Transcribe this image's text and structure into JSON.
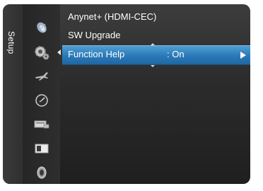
{
  "sidebar": {
    "title": "Setup",
    "icons": [
      {
        "name": "satellite-dish-icon",
        "selected": false
      },
      {
        "name": "setup-gears-icon",
        "selected": true
      },
      {
        "name": "plane-icon",
        "selected": false
      },
      {
        "name": "clock-icon",
        "selected": false
      },
      {
        "name": "input-icon",
        "selected": false
      },
      {
        "name": "picture-icon",
        "selected": false
      },
      {
        "name": "sound-icon",
        "selected": false
      }
    ]
  },
  "menu": {
    "items": [
      {
        "label": "Anynet+ (HDMI-CEC)",
        "value": ""
      },
      {
        "label": "SW Upgrade",
        "value": ""
      },
      {
        "label": "Function Help",
        "value": ": On"
      }
    ]
  },
  "colors": {
    "highlight": "#2a78b7",
    "panel_bg": "#2b2b2b"
  }
}
